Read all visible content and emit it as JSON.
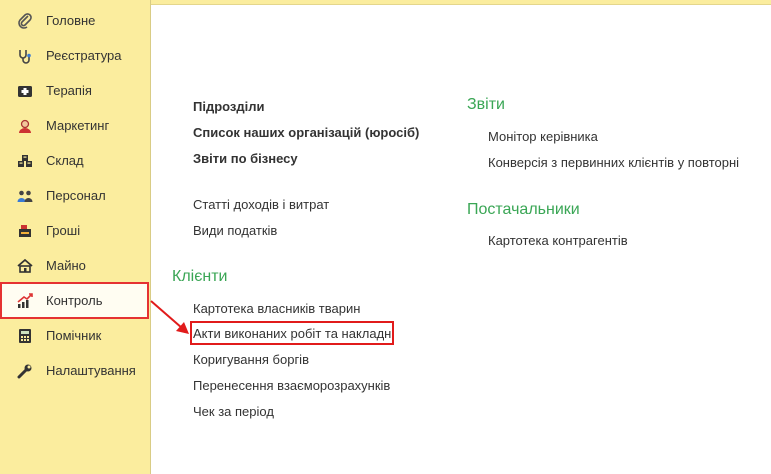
{
  "sidebar": {
    "items": [
      {
        "label": "Головне",
        "icon": "paperclip-icon"
      },
      {
        "label": "Реєстратура",
        "icon": "stethoscope-icon"
      },
      {
        "label": "Терапія",
        "icon": "first-aid-kit-icon"
      },
      {
        "label": "Маркетинг",
        "icon": "user-headset-icon"
      },
      {
        "label": "Склад",
        "icon": "boxes-icon"
      },
      {
        "label": "Персонал",
        "icon": "people-icon"
      },
      {
        "label": "Гроші",
        "icon": "cash-register-icon"
      },
      {
        "label": "Майно",
        "icon": "house-icon"
      },
      {
        "label": "Контроль",
        "icon": "chart-up-icon",
        "highlighted": true
      },
      {
        "label": "Помічник",
        "icon": "calculator-icon"
      },
      {
        "label": "Налаштування",
        "icon": "wrench-icon"
      }
    ]
  },
  "main": {
    "col1": {
      "bold_links": [
        "Підрозділи",
        "Список наших організацій (юросіб)",
        "Звіти по бізнесу"
      ],
      "links": [
        "Статті доходів і витрат",
        "Види податків"
      ]
    },
    "clients": {
      "title": "Клієнти",
      "links": [
        "Картотека власників тварин",
        "Акти виконаних робіт та накладні",
        "Коригування боргів",
        "Перенесення взаєморозрахунків",
        "Чек за період"
      ]
    },
    "reports": {
      "title": "Звіти",
      "links": [
        "Монітор керівника",
        "Конверсія з первинних клієнтів у повторні"
      ]
    },
    "suppliers": {
      "title": "Постачальники",
      "links": [
        "Картотека контрагентів"
      ]
    }
  },
  "colors": {
    "sidebar_bg": "#fbed9e",
    "section_title": "#3aa655",
    "highlight_red": "#e11b1b"
  }
}
